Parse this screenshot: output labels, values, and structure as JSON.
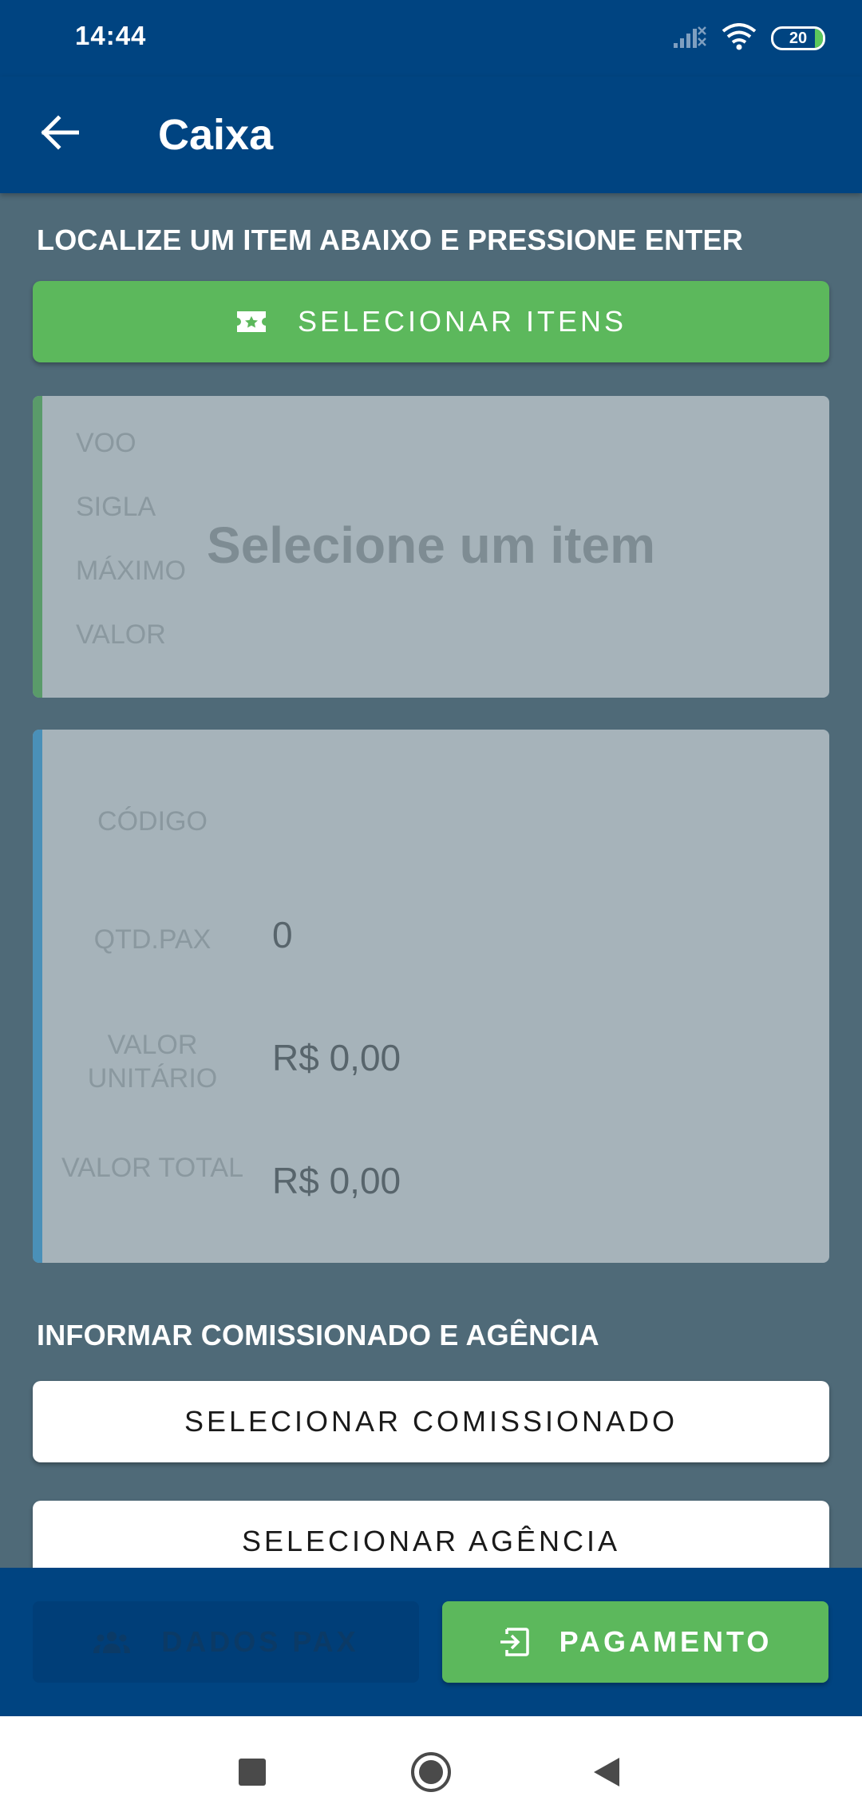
{
  "status_bar": {
    "time": "14:44",
    "battery": "20",
    "icons": [
      "signal-off-icon",
      "wifi-icon",
      "battery-icon"
    ]
  },
  "app_bar": {
    "title": "Caixa",
    "back_icon": "arrow-left-icon"
  },
  "item_section": {
    "heading": "LOCALIZE UM ITEM ABAIXO E PRESSIONE ENTER",
    "select_button": "SELECIONAR ITENS",
    "select_icon": "ticket-icon"
  },
  "item_card": {
    "labels": [
      "VOO",
      "SIGLA",
      "MÁXIMO",
      "VALOR"
    ],
    "placeholder": "Selecione um item"
  },
  "summary_card": {
    "codigo_label": "CÓDIGO",
    "codigo_value": "",
    "qtd_label": "QTD.PAX",
    "qtd_value": "0",
    "unit_label": "VALOR UNITÁRIO",
    "unit_value": "R$ 0,00",
    "total_label": "VALOR TOTAL",
    "total_value": "R$ 0,00"
  },
  "commission_section": {
    "heading": "INFORMAR COMISSIONADO E AGÊNCIA",
    "commissioned_button": "SELECIONAR COMISSIONADO",
    "agency_button": "SELECIONAR AGÊNCIA"
  },
  "bottom_bar": {
    "pax_button": "DADOS PAX",
    "pax_icon": "people-icon",
    "payment_button": "PAGAMENTO",
    "payment_icon": "exit-to-app-icon"
  },
  "nav_bar": {
    "icons": [
      "recents-square-icon",
      "home-circle-icon",
      "back-triangle-icon"
    ]
  },
  "colors": {
    "primary": "#004481",
    "accent_green": "#5cb85c",
    "background": "#4f6a78",
    "card": "#a6b3ba",
    "item_accent": "#5a9b6a",
    "summary_accent": "#4a90b8"
  }
}
